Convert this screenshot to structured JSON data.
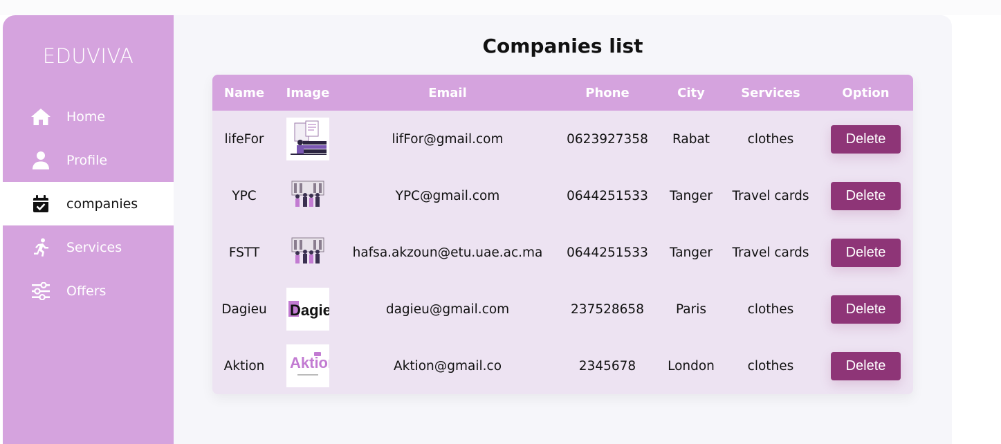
{
  "brand": "EDUVIVA",
  "nav": {
    "items": [
      {
        "label": "Home",
        "icon": "home-icon"
      },
      {
        "label": "Profile",
        "icon": "user-icon"
      },
      {
        "label": "companies",
        "icon": "calendar-check-icon"
      },
      {
        "label": "Services",
        "icon": "running-icon"
      },
      {
        "label": "Offers",
        "icon": "sliders-icon"
      }
    ],
    "active": "companies"
  },
  "main": {
    "title": "Companies list",
    "columns": [
      "Name",
      "Image",
      "Email",
      "Phone",
      "City",
      "Services",
      "Option"
    ],
    "rows": [
      {
        "name": "lifeFor",
        "image": "lifefor-logo",
        "email": "lifFor@gmail.com",
        "phone": "0623927358",
        "city": "Rabat",
        "services": "clothes",
        "option": "Delete"
      },
      {
        "name": "YPC",
        "image": "ypc-logo",
        "email": "YPC@gmail.com",
        "phone": "0644251533",
        "city": "Tanger",
        "services": "Travel cards",
        "option": "Delete"
      },
      {
        "name": "FSTT",
        "image": "fstt-logo",
        "email": "hafsa.akzoun@etu.uae.ac.ma",
        "phone": "0644251533",
        "city": "Tanger",
        "services": "Travel cards",
        "option": "Delete"
      },
      {
        "name": "Dagieu",
        "image": "dagieu-logo",
        "email": "dagieu@gmail.com",
        "phone": "237528658",
        "city": "Paris",
        "services": "clothes",
        "option": "Delete"
      },
      {
        "name": "Aktion",
        "image": "aktion-logo",
        "email": "Aktion@gmail.co",
        "phone": "2345678",
        "city": "London",
        "services": "clothes",
        "option": "Delete"
      }
    ],
    "logo_text": {
      "dagieu": "Dagieu",
      "aktion": "Aktion"
    }
  },
  "colors": {
    "sidebar": "#d5a3de",
    "table_body": "#ede3f2",
    "delete_button": "#8e3577",
    "main_bg": "#f6f6fa"
  }
}
